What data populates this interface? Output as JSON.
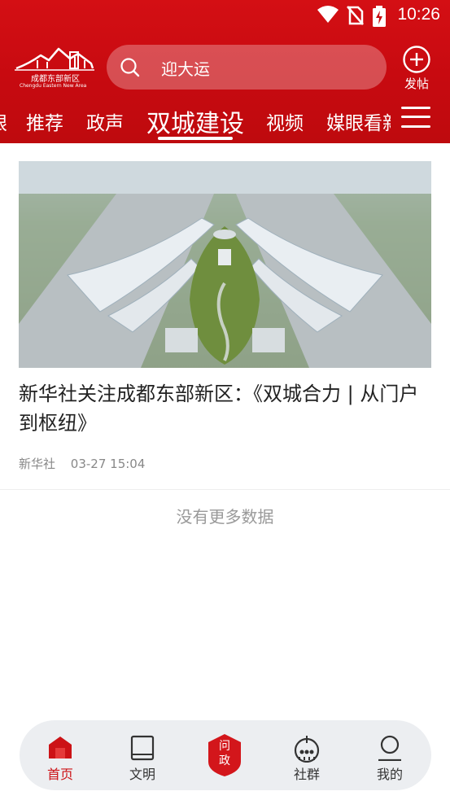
{
  "status_bar": {
    "time": "10:26",
    "icons": [
      "wifi-icon",
      "no-sim-icon",
      "battery-charging-icon"
    ]
  },
  "header": {
    "logo": {
      "name": "成都东部新区",
      "subtitle": "Chengdu Eastern New Area"
    },
    "search": {
      "text": "迎大运",
      "icon": "search-icon"
    },
    "post_button": {
      "label": "发帖",
      "icon": "plus-circle-icon"
    },
    "tabs": [
      {
        "label": "眼",
        "active": false
      },
      {
        "label": "推荐",
        "active": false
      },
      {
        "label": "政声",
        "active": false
      },
      {
        "label": "双城建设",
        "active": true
      },
      {
        "label": "视频",
        "active": false
      },
      {
        "label": "媒眼看新",
        "active": false
      }
    ],
    "menu_icon": "hamburger-menu-icon",
    "accent_color": "#c70a10"
  },
  "article": {
    "image_alt": "aerial-airport-photo",
    "title": "新华社关注成都东部新区：《双城合力 | 从门户到枢纽》",
    "source": "新华社",
    "time": "03-27 15:04"
  },
  "list_footer": "没有更多数据",
  "bottom_nav": {
    "items": [
      {
        "label": "首页",
        "icon": "home-icon",
        "active": true
      },
      {
        "label": "文明",
        "icon": "book-icon",
        "active": false
      },
      {
        "label": "问政",
        "icon": "shield-badge-icon",
        "active": false
      },
      {
        "label": "社群",
        "icon": "community-icon",
        "active": false
      },
      {
        "label": "我的",
        "icon": "user-icon",
        "active": false
      }
    ],
    "active_color": "#cc1216"
  }
}
